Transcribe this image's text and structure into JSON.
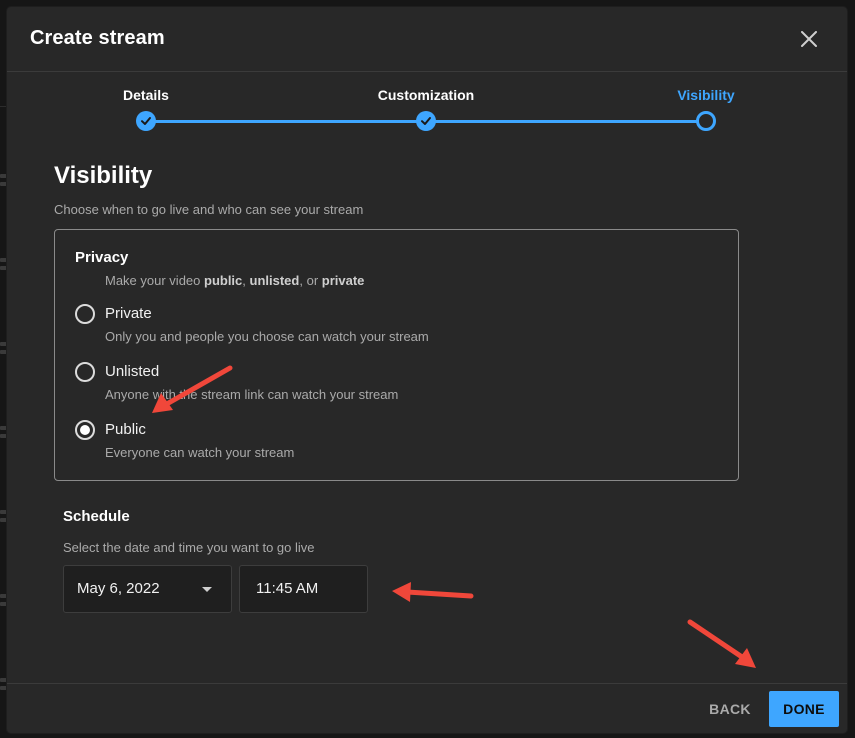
{
  "dialog": {
    "title": "Create stream",
    "close_icon": "close-icon"
  },
  "stepper": {
    "steps": [
      {
        "label": "Details",
        "state": "done"
      },
      {
        "label": "Customization",
        "state": "done"
      },
      {
        "label": "Visibility",
        "state": "current"
      }
    ],
    "accent_color": "#3ea6ff"
  },
  "visibility": {
    "heading": "Visibility",
    "subheading": "Choose when to go live and who can see your stream"
  },
  "privacy": {
    "title": "Privacy",
    "desc_prefix": "Make your video ",
    "desc_public": "public",
    "desc_sep1": ", ",
    "desc_unlisted": "unlisted",
    "desc_sep2": ", or ",
    "desc_private": "private",
    "options": [
      {
        "label": "Private",
        "description": "Only you and people you choose can watch your stream",
        "selected": false
      },
      {
        "label": "Unlisted",
        "description": "Anyone with the stream link can watch your stream",
        "selected": false
      },
      {
        "label": "Public",
        "description": "Everyone can watch your stream",
        "selected": true
      }
    ]
  },
  "schedule": {
    "title": "Schedule",
    "subtitle": "Select the date and time you want to go live",
    "date_value": "May 6, 2022",
    "time_value": "11:45 AM"
  },
  "footer": {
    "back_label": "BACK",
    "done_label": "DONE"
  },
  "annotations": {
    "arrow_color": "#f0473a",
    "arrow_icon": "red-arrow-annotation"
  }
}
